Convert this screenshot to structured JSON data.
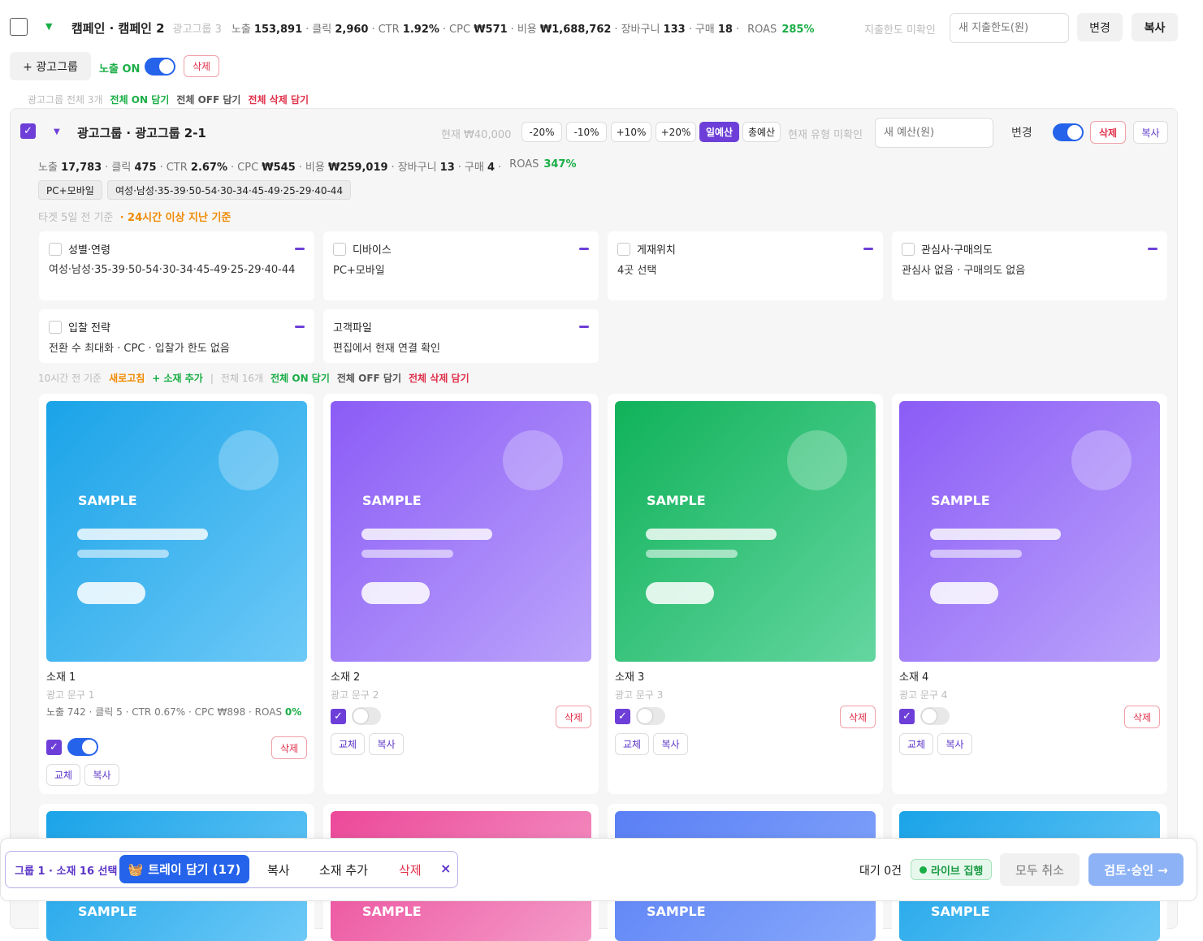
{
  "campaign": {
    "name": "캠페인 · 캠페인 2",
    "adgroups": "광고그룹 3",
    "stats": [
      {
        "l": "노출",
        "v": "153,891"
      },
      {
        "l": "클릭",
        "v": "2,960"
      },
      {
        "l": "CTR",
        "v": "1.92%"
      },
      {
        "l": "CPC",
        "v": "₩571"
      },
      {
        "l": "비용",
        "v": "₩1,688,762"
      },
      {
        "l": "장바구니",
        "v": "133"
      },
      {
        "l": "구매",
        "v": "18"
      }
    ],
    "roas_label": "ROAS",
    "roas": "285%",
    "limit_status": "지출한도 미확인",
    "limit_placeholder": "새 지출한도(원)",
    "change": "변경",
    "copy": "복사"
  },
  "toolbar": {
    "add_group": "+ 광고그룹",
    "exposure": "노출 ON",
    "delete": "삭제"
  },
  "bulk": {
    "total": "광고그룹 전체 3개",
    "all_on": "전체 ON 담기",
    "all_off": "전체 OFF 담기",
    "all_del": "전체 삭제 담기"
  },
  "adgroup": {
    "name": "광고그룹 · 광고그룹 2-1",
    "budget_current": "현재 ₩40,000",
    "adj": [
      "-20%",
      "-10%",
      "+10%",
      "+20%"
    ],
    "daily": "일예산",
    "total": "총예산",
    "type_status": "현재 유형 미확인",
    "budget_placeholder": "새 예산(원)",
    "change": "변경",
    "delete": "삭제",
    "copy": "복사",
    "stats": [
      {
        "l": "노출",
        "v": "17,783"
      },
      {
        "l": "클릭",
        "v": "475"
      },
      {
        "l": "CTR",
        "v": "2.67%"
      },
      {
        "l": "CPC",
        "v": "₩545"
      },
      {
        "l": "비용",
        "v": "₩259,019"
      },
      {
        "l": "장바구니",
        "v": "13"
      },
      {
        "l": "구매",
        "v": "4"
      }
    ],
    "roas_label": "ROAS",
    "roas": "347%",
    "chip1": "PC+모바일",
    "chip2": "여성·남성·35-39·50-54·30-34·45-49·25-29·40-44",
    "target_time": "타겟 5일 전 기준",
    "target_warn": "· 24시간 이상 지난 기준"
  },
  "targets": [
    {
      "t": "성별·연령",
      "b": "여성·남성·35-39·50-54·30-34·45-49·25-29·40-44",
      "cb": true
    },
    {
      "t": "디바이스",
      "b": "PC+모바일",
      "cb": true
    },
    {
      "t": "게재위치",
      "b": "4곳 선택",
      "cb": true
    },
    {
      "t": "관심사·구매의도",
      "b": "관심사 없음 · 구매의도 없음",
      "cb": true
    },
    {
      "t": "입찰 전략",
      "b": "전환 수 최대화 · CPC · 입찰가 한도 없음",
      "cb": true
    },
    {
      "t": "고객파일",
      "b": "편집에서 현재 연결 확인",
      "cb": false
    }
  ],
  "creative_bar": {
    "time": "10시간 전 기준",
    "refresh": "새로고침",
    "add": "+ 소재 추가",
    "total": "전체 16개",
    "all_on": "전체 ON 담기",
    "all_off": "전체 OFF 담기",
    "all_del": "전체 삭제 담기"
  },
  "creatives": [
    {
      "name": "소재 1",
      "copy": "광고 문구 1",
      "sample": "SAMPLE",
      "stats": "노출 742 · 클릭 5 · CTR 0.67% · CPC ₩898 · ROAS",
      "roas": "0%",
      "replace": "교체",
      "dup": "복사",
      "delete": "삭제"
    },
    {
      "name": "소재 2",
      "copy": "광고 문구 2",
      "sample": "SAMPLE",
      "replace": "교체",
      "dup": "복사",
      "delete": "삭제"
    },
    {
      "name": "소재 3",
      "copy": "광고 문구 3",
      "sample": "SAMPLE",
      "replace": "교체",
      "dup": "복사",
      "delete": "삭제"
    },
    {
      "name": "소재 4",
      "copy": "광고 문구 4",
      "sample": "SAMPLE",
      "replace": "교체",
      "dup": "복사",
      "delete": "삭제"
    }
  ],
  "bottom_samples": [
    "SAMPLE",
    "SAMPLE",
    "SAMPLE",
    "SAMPLE"
  ],
  "actionbar": {
    "selection": "그룹 1 · 소재 16 선택",
    "tray": "트레이 담기 (17)",
    "copy": "복사",
    "add": "소재 추가",
    "delete": "삭제",
    "close": "×",
    "pending": "대기 0건",
    "live": "라이브 집행",
    "cancel": "모두 취소",
    "review": "검토·승인 →"
  },
  "colors": {
    "accent": "#6d3fd8",
    "toggle": "#2563eb",
    "danger": "#e0304a",
    "success": "#1aae46",
    "warn": "#f08a00"
  }
}
